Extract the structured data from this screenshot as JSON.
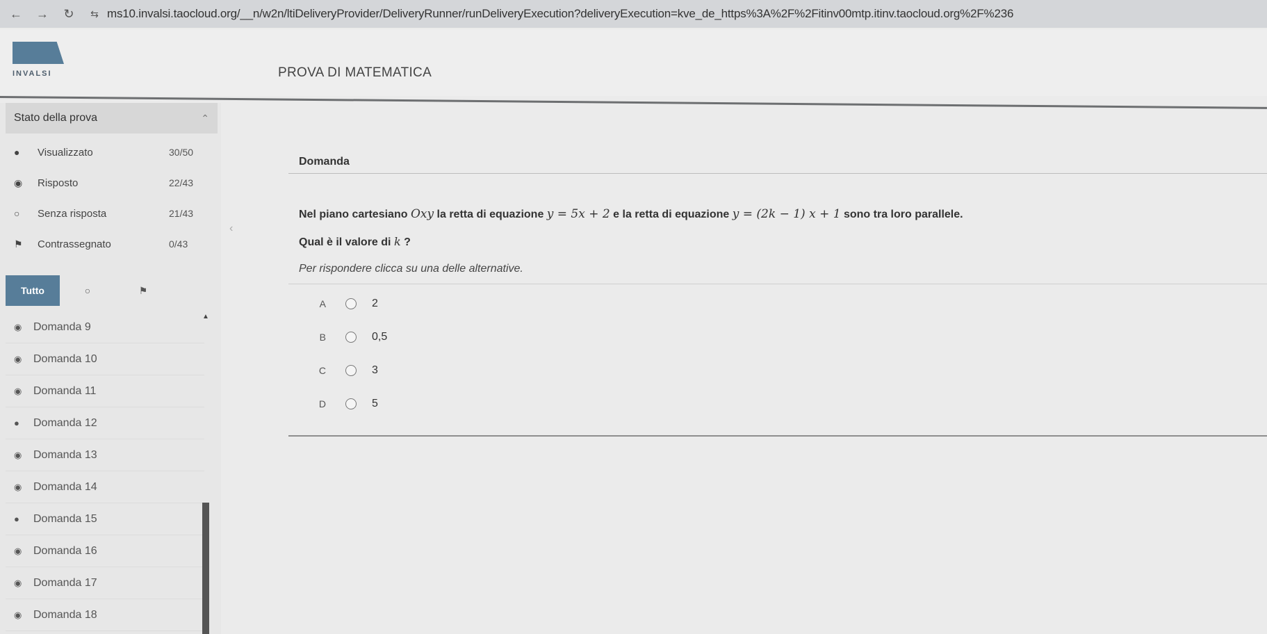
{
  "browser": {
    "url": "ms10.invalsi.taocloud.org/__n/w2n/ltiDeliveryProvider/DeliveryRunner/runDeliveryExecution?deliveryExecution=kve_de_https%3A%2F%2Fitinv00mtp.itinv.taocloud.org%2F%236"
  },
  "header": {
    "logo_text": "INVALSI",
    "title": "PROVA DI MATEMATICA"
  },
  "sidebar": {
    "status_title": "Stato della prova",
    "status_items": [
      {
        "label": "Visualizzato",
        "count": "30/50",
        "icon": "filled-dot-icon"
      },
      {
        "label": "Risposto",
        "count": "22/43",
        "icon": "answered-icon"
      },
      {
        "label": "Senza risposta",
        "count": "21/43",
        "icon": "empty-circle-icon"
      },
      {
        "label": "Contrassegnato",
        "count": "0/43",
        "icon": "flag-icon"
      }
    ],
    "filter_all": "Tutto",
    "questions": [
      {
        "label": "Domanda 9",
        "icon": "answered-icon"
      },
      {
        "label": "Domanda 10",
        "icon": "answered-icon"
      },
      {
        "label": "Domanda 11",
        "icon": "answered-icon"
      },
      {
        "label": "Domanda 12",
        "icon": "filled-dot-icon"
      },
      {
        "label": "Domanda 13",
        "icon": "answered-icon"
      },
      {
        "label": "Domanda 14",
        "icon": "answered-icon"
      },
      {
        "label": "Domanda 15",
        "icon": "filled-dot-icon"
      },
      {
        "label": "Domanda 16",
        "icon": "answered-icon"
      },
      {
        "label": "Domanda 17",
        "icon": "answered-icon"
      },
      {
        "label": "Domanda 18",
        "icon": "answered-icon"
      }
    ]
  },
  "question": {
    "header": "Domanda",
    "text_part1": "Nel piano cartesiano ",
    "text_axes": "Oxy",
    "text_part2": " la retta di equazione ",
    "eq1": "y = 5x + 2",
    "text_part3": " e la retta di equazione ",
    "eq2": "y = (2k − 1) x + 1",
    "text_part4": " sono tra loro parallele.",
    "subquestion_prefix": "Qual è il valore di ",
    "subquestion_var": "k",
    "subquestion_suffix": " ?",
    "instruction": "Per rispondere clicca su una delle alternative.",
    "answers": [
      {
        "letter": "A",
        "value": "2"
      },
      {
        "letter": "B",
        "value": "0,5"
      },
      {
        "letter": "C",
        "value": "3"
      },
      {
        "letter": "D",
        "value": "5"
      }
    ]
  }
}
